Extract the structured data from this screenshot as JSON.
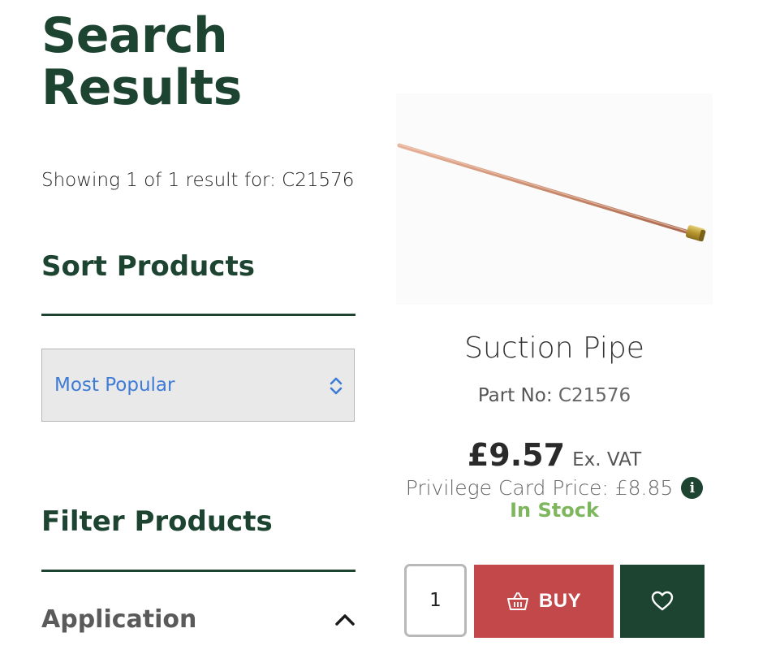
{
  "page": {
    "title": "Search Results",
    "results_summary": "Showing 1 of 1 result for: C21576"
  },
  "sort": {
    "heading": "Sort Products",
    "selected": "Most Popular"
  },
  "filter": {
    "heading": "Filter Products",
    "groups": [
      {
        "label": "Application",
        "expanded": true
      }
    ]
  },
  "product": {
    "name": "Suction Pipe",
    "part_no_label": "Part No:",
    "part_no": "C21576",
    "price": "£9.57",
    "price_suffix": "Ex. VAT",
    "privilege_price": "Privilege Card Price: £8.85",
    "stock_status": "In Stock",
    "quantity": "1",
    "buy_label": "BUY"
  },
  "icons": {
    "sort_select": "updown-chevron-icon",
    "filter_toggle": "chevron-up-icon",
    "info": "info-icon",
    "basket": "basket-icon",
    "wishlist": "heart-icon"
  },
  "colors": {
    "brand_green": "#1c4431",
    "buy_red": "#c2484a",
    "stock_green": "#7db65c",
    "select_text_blue": "#3d7bd6"
  }
}
